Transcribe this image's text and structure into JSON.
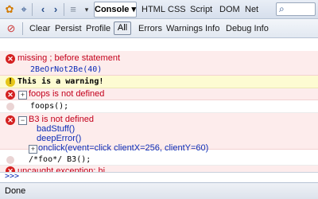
{
  "toolbar": {
    "console_tab": "Console ▾",
    "tabs": [
      "HTML",
      "CSS",
      "Script",
      "DOM",
      "Net"
    ],
    "search_icon": "⌕"
  },
  "filters": {
    "clear": "Clear",
    "persist": "Persist",
    "profile": "Profile",
    "all": "All",
    "errors": "Errors",
    "warnings": "Warnings",
    "info": "Info",
    "debug_info": "Debug Info"
  },
  "log": {
    "r1_msg": "missing ; before statement",
    "r1_code": "2BeOrNot2Be(40)",
    "r2_msg": "This is a warning!",
    "r3_msg": "foops is not defined",
    "r3_code": "foops();",
    "r4_msg": "B3 is not defined",
    "r4_stack1": "badStuff()",
    "r4_stack2": "deepError()",
    "r4_stack3": "onclick(event=click clientX=256, clientY=60)",
    "r5_code": "/*foo*/ B3();",
    "r6_msg": "uncaught exception: hi"
  },
  "command": {
    "prompt": ">>>"
  },
  "status": {
    "text": "Done"
  },
  "colors": {
    "error_bg": "#fdecec",
    "warn_bg": "#fdfbd2",
    "error_text": "#c3001b",
    "link_blue": "#0b2bb6"
  }
}
